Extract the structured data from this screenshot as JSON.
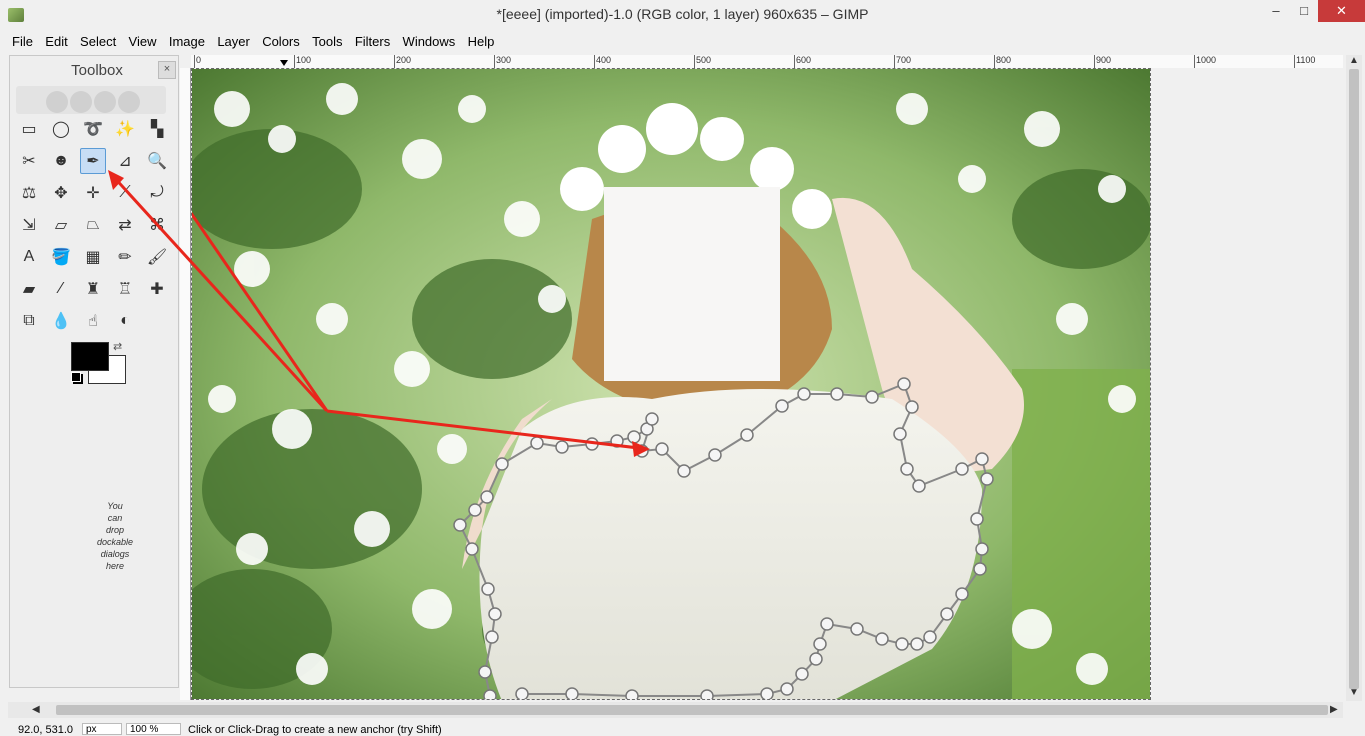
{
  "window": {
    "title": "*[eeee] (imported)-1.0 (RGB color, 1 layer) 960x635 – GIMP",
    "minimize": "–",
    "maximize": "□",
    "close": "✕"
  },
  "menu": [
    {
      "label": "File"
    },
    {
      "label": "Edit"
    },
    {
      "label": "Select"
    },
    {
      "label": "View"
    },
    {
      "label": "Image"
    },
    {
      "label": "Layer"
    },
    {
      "label": "Colors"
    },
    {
      "label": "Tools"
    },
    {
      "label": "Filters"
    },
    {
      "label": "Windows"
    },
    {
      "label": "Help"
    }
  ],
  "toolbox": {
    "title": "Toolbox",
    "close": "×",
    "dock_hint": "You\ncan\ndrop\ndockable\ndialogs\nhere",
    "fg_color": "#000000",
    "bg_color": "#ffffff",
    "tools": [
      {
        "name": "rect-select-icon",
        "glyph": "▭"
      },
      {
        "name": "ellipse-select-icon",
        "glyph": "◯"
      },
      {
        "name": "free-select-icon",
        "glyph": "➰"
      },
      {
        "name": "fuzzy-select-icon",
        "glyph": "✨"
      },
      {
        "name": "color-select-icon",
        "glyph": "▚"
      },
      {
        "name": "scissors-select-icon",
        "glyph": "✂"
      },
      {
        "name": "foreground-select-icon",
        "glyph": "☻"
      },
      {
        "name": "paths-tool-icon",
        "glyph": "✒",
        "active": true
      },
      {
        "name": "color-picker-icon",
        "glyph": "⊿"
      },
      {
        "name": "zoom-icon",
        "glyph": "🔍"
      },
      {
        "name": "measure-icon",
        "glyph": "⚖"
      },
      {
        "name": "move-icon",
        "glyph": "✥"
      },
      {
        "name": "align-icon",
        "glyph": "✛"
      },
      {
        "name": "crop-icon",
        "glyph": "⟋"
      },
      {
        "name": "rotate-icon",
        "glyph": "⤾"
      },
      {
        "name": "scale-icon",
        "glyph": "⇲"
      },
      {
        "name": "shear-icon",
        "glyph": "▱"
      },
      {
        "name": "perspective-icon",
        "glyph": "⏢"
      },
      {
        "name": "flip-icon",
        "glyph": "⇄"
      },
      {
        "name": "cage-transform-icon",
        "glyph": "⌘"
      },
      {
        "name": "text-tool-icon",
        "glyph": "A"
      },
      {
        "name": "bucket-fill-icon",
        "glyph": "🪣"
      },
      {
        "name": "blend-icon",
        "glyph": "▦"
      },
      {
        "name": "pencil-icon",
        "glyph": "✏"
      },
      {
        "name": "paintbrush-icon",
        "glyph": "🖌"
      },
      {
        "name": "eraser-icon",
        "glyph": "▰"
      },
      {
        "name": "airbrush-icon",
        "glyph": "⁄"
      },
      {
        "name": "ink-icon",
        "glyph": "♜"
      },
      {
        "name": "clone-icon",
        "glyph": "♖"
      },
      {
        "name": "heal-icon",
        "glyph": "✚"
      },
      {
        "name": "perspective-clone-icon",
        "glyph": "⧉"
      },
      {
        "name": "blur-sharpen-icon",
        "glyph": "💧"
      },
      {
        "name": "smudge-icon",
        "glyph": "☝"
      },
      {
        "name": "dodge-burn-icon",
        "glyph": "◐"
      }
    ]
  },
  "ruler": {
    "labels": [
      "0",
      "100",
      "200",
      "300",
      "400",
      "500",
      "600",
      "700",
      "800",
      "900",
      "1000",
      "1100"
    ]
  },
  "status": {
    "coords": "92.0, 531.0",
    "unit": "px",
    "zoom": "100 %",
    "message": "Click or Click-Drag to create a new anchor (try Shift)"
  },
  "colors": {
    "arrow": "#e8261c",
    "accent": "#5b9bd5"
  }
}
